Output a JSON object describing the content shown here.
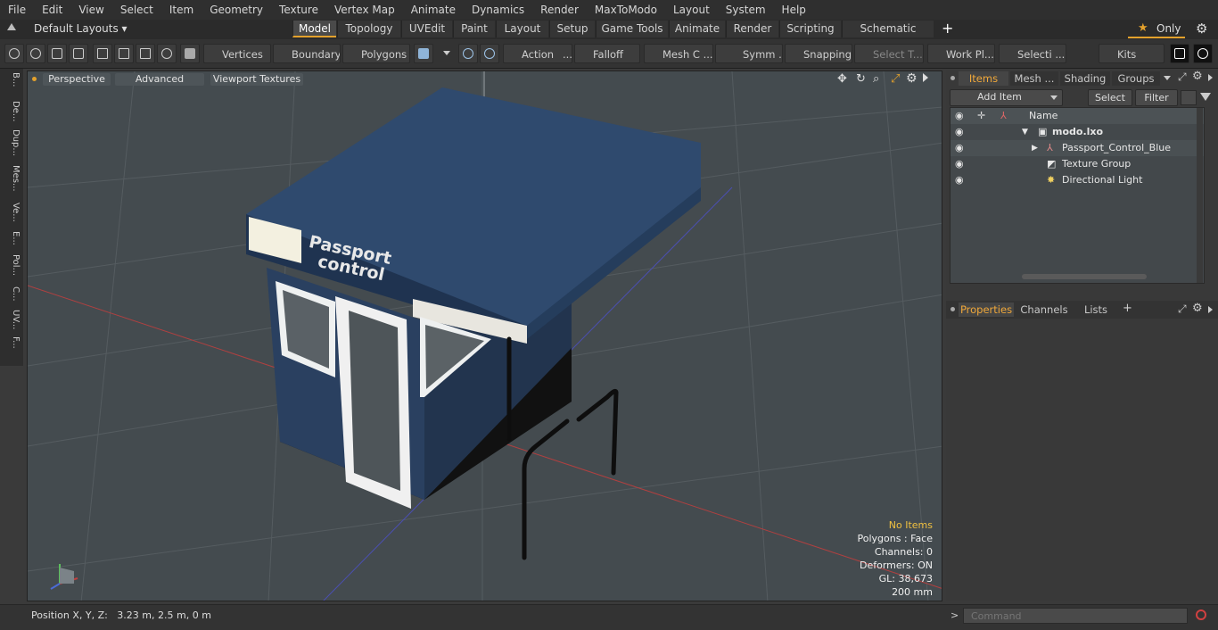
{
  "menu": [
    "File",
    "Edit",
    "View",
    "Select",
    "Item",
    "Geometry",
    "Texture",
    "Vertex Map",
    "Animate",
    "Dynamics",
    "Render",
    "MaxToModo",
    "Layout",
    "System",
    "Help"
  ],
  "layout_selector": "Default Layouts ▾",
  "layout_tabs": [
    "Model",
    "Topology",
    "UVEdit",
    "Paint",
    "Layout",
    "Setup",
    "Game Tools",
    "Animate",
    "Render",
    "Scripting",
    "Schematic Fusion"
  ],
  "only_label": "Only",
  "toolbar": {
    "vertices": "Vertices",
    "boundary": "Boundary",
    "polygons": "Polygons",
    "action": "Action",
    "action_more": "...",
    "falloff": "Falloff",
    "mesh": "Mesh C ...",
    "symm": "Symm ...",
    "snapping": "Snapping",
    "select_t": "Select T...",
    "work_pl": "Work Pl...",
    "selecti": "Selecti ...",
    "kits": "Kits"
  },
  "left_tabs": [
    "B...",
    "De...",
    "Dup...",
    "Mes...",
    "Ve...",
    "E...",
    "Pol...",
    "C...",
    "UV...",
    "F..."
  ],
  "viewport": {
    "perspective": "Perspective",
    "advanced": "Advanced",
    "textures": "Viewport Textures",
    "sign_line1": "Passport",
    "sign_line2": "control",
    "info": {
      "no_items": "No Items",
      "polygons": "Polygons : Face",
      "channels": "Channels: 0",
      "deformers": "Deformers: ON",
      "gl": "GL: 38,673",
      "scale": "200 mm"
    }
  },
  "right_panel": {
    "tabs": [
      "Items",
      "Mesh ...",
      "Shading",
      "Groups"
    ],
    "add_item": "Add Item",
    "select": "Select",
    "filter": "Filter",
    "name_col": "Name",
    "items": [
      {
        "label": "modo.lxo"
      },
      {
        "label": "Passport_Control_Blue"
      },
      {
        "label": "Texture Group"
      },
      {
        "label": "Directional Light"
      }
    ],
    "bottom_tabs": [
      "Properties",
      "Channels",
      "Lists"
    ]
  },
  "status": {
    "position": "Position X, Y, Z:   3.23 m, 2.5 m, 0 m",
    "command_placeholder": "Command"
  },
  "colors": {
    "accent": "#e3a12c",
    "viewport": "#444b4f"
  }
}
